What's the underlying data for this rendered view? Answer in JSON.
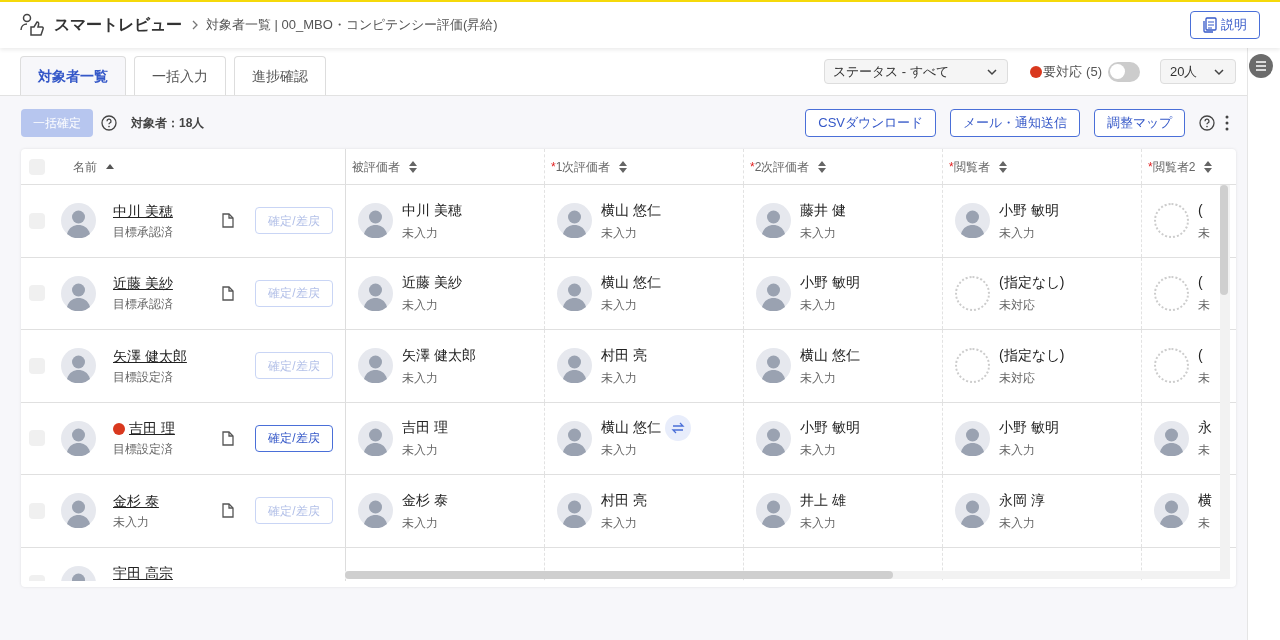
{
  "header": {
    "app_name": "スマートレビュー",
    "breadcrumb": "対象者一覧 | 00_MBO・コンピテンシー評価(昇給)",
    "help_button": "説明"
  },
  "tabs": [
    {
      "label": "対象者一覧",
      "selected": true
    },
    {
      "label": "一括入力",
      "selected": false
    },
    {
      "label": "進捗確認",
      "selected": false
    }
  ],
  "filters": {
    "status_select": "ステータス - すべて",
    "attention_label": "要対応",
    "attention_count": "(5)",
    "attention_toggle_on": false,
    "page_size": "20人"
  },
  "toolbar": {
    "bulk_confirm": {
      "label": "一括確定",
      "disabled": true
    },
    "count_label": "対象者：18人",
    "buttons": [
      "CSVダウンロード",
      "メール・通知送信",
      "調整マップ"
    ]
  },
  "table": {
    "select_all_checked": false,
    "columns": [
      {
        "label": "名前",
        "sorted": true
      },
      {
        "label": "被評価者",
        "sorted": false
      },
      {
        "required_mark": "*",
        "label": "1次評価者",
        "sorted": false
      },
      {
        "required_mark": "*",
        "label": "2次評価者",
        "sorted": false
      },
      {
        "required_mark": "*",
        "label": "閲覧者",
        "sorted": false
      },
      {
        "required_mark": "*",
        "label": "閲覧者2",
        "sorted": false
      }
    ],
    "rows": [
      {
        "checked": false,
        "name": "中川 美穂",
        "status": "目標承認済",
        "attention": false,
        "document": true,
        "action": {
          "label": "確定/差戻",
          "disabled": true
        },
        "cells": [
          {
            "name": "中川 美穂",
            "status": "未入力",
            "assigned": true,
            "swap": false
          },
          {
            "name": "横山 悠仁",
            "status": "未入力",
            "assigned": true,
            "swap": false
          },
          {
            "name": "藤井 健",
            "status": "未入力",
            "assigned": true,
            "swap": false
          },
          {
            "name": "小野 敏明",
            "status": "未入力",
            "assigned": true,
            "swap": false
          },
          {
            "name": "(",
            "status": "未",
            "assigned": false,
            "swap": false
          }
        ]
      },
      {
        "checked": false,
        "name": "近藤 美紗",
        "status": "目標承認済",
        "attention": false,
        "document": true,
        "action": {
          "label": "確定/差戻",
          "disabled": true
        },
        "cells": [
          {
            "name": "近藤 美紗",
            "status": "未入力",
            "assigned": true,
            "swap": false
          },
          {
            "name": "横山 悠仁",
            "status": "未入力",
            "assigned": true,
            "swap": false
          },
          {
            "name": "小野 敏明",
            "status": "未入力",
            "assigned": true,
            "swap": false
          },
          {
            "name": "(指定なし)",
            "status": "未対応",
            "assigned": false,
            "swap": false
          },
          {
            "name": "(",
            "status": "未",
            "assigned": false,
            "swap": false
          }
        ]
      },
      {
        "checked": false,
        "name": "矢澤 健太郎",
        "status": "目標設定済",
        "attention": false,
        "document": false,
        "action": {
          "label": "確定/差戻",
          "disabled": true
        },
        "cells": [
          {
            "name": "矢澤 健太郎",
            "status": "未入力",
            "assigned": true,
            "swap": false
          },
          {
            "name": "村田 亮",
            "status": "未入力",
            "assigned": true,
            "swap": false
          },
          {
            "name": "横山 悠仁",
            "status": "未入力",
            "assigned": true,
            "swap": false
          },
          {
            "name": "(指定なし)",
            "status": "未対応",
            "assigned": false,
            "swap": false
          },
          {
            "name": "(",
            "status": "未",
            "assigned": false,
            "swap": false
          }
        ]
      },
      {
        "checked": false,
        "name": "吉田 理",
        "status": "目標設定済",
        "attention": true,
        "document": true,
        "action": {
          "label": "確定/差戻",
          "disabled": false
        },
        "cells": [
          {
            "name": "吉田 理",
            "status": "未入力",
            "assigned": true,
            "swap": false
          },
          {
            "name": "横山 悠仁",
            "status": "未入力",
            "assigned": true,
            "swap": true
          },
          {
            "name": "小野 敏明",
            "status": "未入力",
            "assigned": true,
            "swap": false
          },
          {
            "name": "小野 敏明",
            "status": "未入力",
            "assigned": true,
            "swap": false
          },
          {
            "name": "永",
            "status": "未",
            "assigned": true,
            "swap": false
          }
        ]
      },
      {
        "checked": false,
        "name": "金杉 泰",
        "status": "未入力",
        "attention": false,
        "document": true,
        "action": {
          "label": "確定/差戻",
          "disabled": true
        },
        "cells": [
          {
            "name": "金杉 泰",
            "status": "未入力",
            "assigned": true,
            "swap": false
          },
          {
            "name": "村田 亮",
            "status": "未入力",
            "assigned": true,
            "swap": false
          },
          {
            "name": "井上 雄",
            "status": "未入力",
            "assigned": true,
            "swap": false
          },
          {
            "name": "永岡 淳",
            "status": "未入力",
            "assigned": true,
            "swap": false
          },
          {
            "name": "横",
            "status": "未",
            "assigned": true,
            "swap": false
          }
        ]
      },
      {
        "checked": false,
        "name": "宇田 高宗"
      }
    ]
  }
}
